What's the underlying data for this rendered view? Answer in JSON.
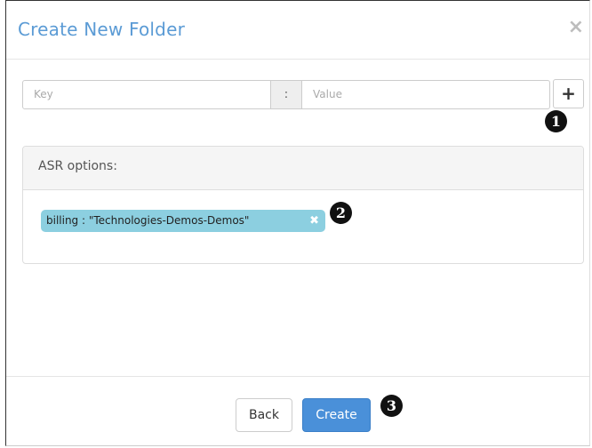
{
  "dialog": {
    "title": "Create New Folder",
    "close_glyph": "×"
  },
  "kv": {
    "key_placeholder": "Key",
    "separator": ":",
    "value_placeholder": "Value",
    "add_glyph": "+"
  },
  "callouts": [
    "1",
    "2",
    "3"
  ],
  "panel": {
    "title": "ASR options:",
    "tags": [
      {
        "label": "billing : \"Technologies-Demos-Demos\"",
        "remove_glyph": "✖"
      }
    ]
  },
  "footer": {
    "back_label": "Back",
    "create_label": "Create"
  },
  "colors": {
    "title": "#5b9bd5",
    "tag_bg": "#8ccfe0",
    "primary": "#4a90d9"
  }
}
